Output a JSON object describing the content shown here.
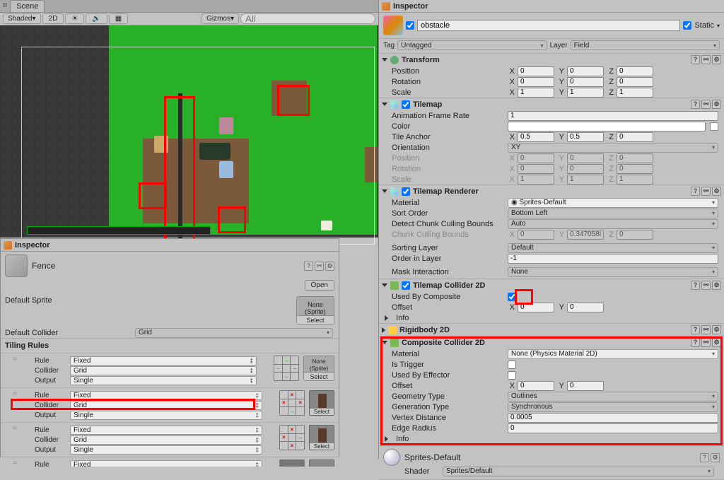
{
  "scene": {
    "tab": "Scene",
    "shading": "Shaded",
    "mode_2d": "2D",
    "gizmos": "Gizmos",
    "search_placeholder": "All"
  },
  "left_inspector": {
    "tab": "Inspector",
    "asset_name": "Fence",
    "open_btn": "Open",
    "default_sprite": "Default Sprite",
    "none_sprite": "None\n(Sprite)",
    "select": "Select",
    "default_collider": "Default Collider",
    "default_collider_val": "Grid",
    "tiling_rules": "Tiling Rules",
    "rule_label": "Rule",
    "collider_label": "Collider",
    "output_label": "Output",
    "rule_val": "Fixed",
    "collider_val": "Grid",
    "output_val": "Single"
  },
  "right_inspector": {
    "tab": "Inspector",
    "obj_name": "obstacle",
    "static": "Static",
    "tag_label": "Tag",
    "tag_val": "Untagged",
    "layer_label": "Layer",
    "layer_val": "Field",
    "transform": {
      "title": "Transform",
      "position": "Position",
      "rotation": "Rotation",
      "scale": "Scale",
      "px": "0",
      "py": "0",
      "pz": "0",
      "rx": "0",
      "ry": "0",
      "rz": "0",
      "sx": "1",
      "sy": "1",
      "sz": "1"
    },
    "tilemap": {
      "title": "Tilemap",
      "afr": "Animation Frame Rate",
      "afr_val": "1",
      "color": "Color",
      "anchor": "Tile Anchor",
      "ax": "0.5",
      "ay": "0.5",
      "az": "0",
      "orient": "Orientation",
      "orient_val": "XY",
      "position": "Position",
      "px": "0",
      "py": "0",
      "pz": "0",
      "rotation": "Rotation",
      "rx": "0",
      "ry": "0",
      "rz": "0",
      "scale": "Scale",
      "sx": "1",
      "sy": "1",
      "sz": "1"
    },
    "tmr": {
      "title": "Tilemap Renderer",
      "material": "Material",
      "material_val": "Sprites-Default",
      "sort": "Sort Order",
      "sort_val": "Bottom Left",
      "dccb": "Detect Chunk Culling Bounds",
      "dccb_val": "Auto",
      "ccb": "Chunk Culling Bounds",
      "cx": "0",
      "cy": "0.3470588",
      "cz": "0",
      "sl": "Sorting Layer",
      "sl_val": "Default",
      "oil": "Order in Layer",
      "oil_val": "-1",
      "mi": "Mask Interaction",
      "mi_val": "None"
    },
    "tc2d": {
      "title": "Tilemap Collider 2D",
      "ubc": "Used By Composite",
      "offset": "Offset",
      "ox": "0",
      "oy": "0",
      "info": "Info"
    },
    "rb2d": {
      "title": "Rigidbody 2D"
    },
    "cc2d": {
      "title": "Composite Collider 2D",
      "material": "Material",
      "material_val": "None (Physics Material 2D)",
      "trigger": "Is Trigger",
      "ube": "Used By Effector",
      "offset": "Offset",
      "ox": "0",
      "oy": "0",
      "gt": "Geometry Type",
      "gt_val": "Outlines",
      "gen": "Generation Type",
      "gen_val": "Synchronous",
      "vd": "Vertex Distance",
      "vd_val": "0.0005",
      "er": "Edge Radius",
      "er_val": "0",
      "info": "Info"
    },
    "mat": {
      "name": "Sprites-Default",
      "shader_label": "Shader",
      "shader_val": "Sprites/Default"
    }
  }
}
